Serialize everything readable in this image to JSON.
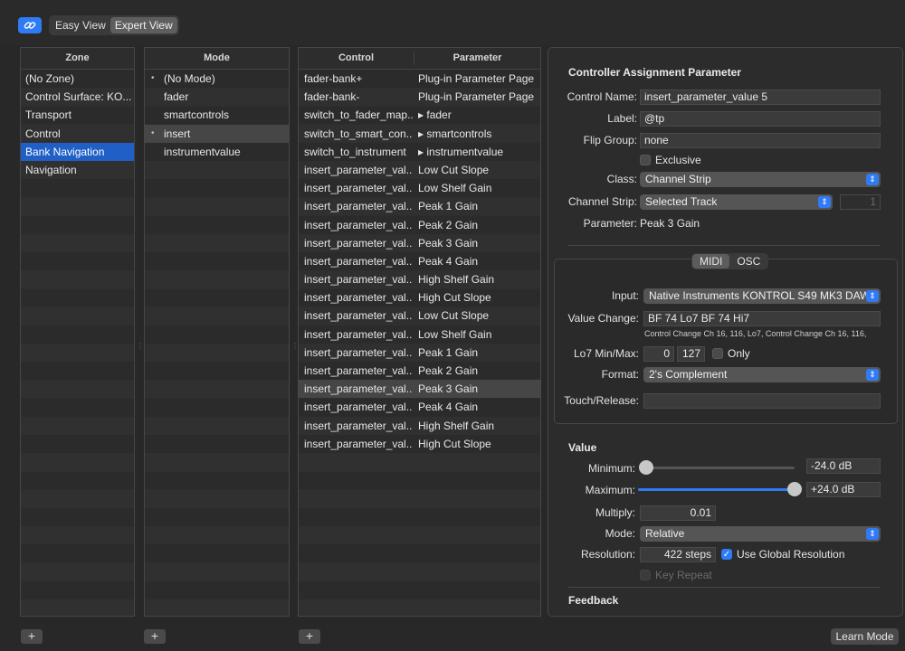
{
  "toolbar": {
    "link_icon": "link-icon",
    "view_modes": [
      "Easy View",
      "Expert View"
    ],
    "active_view": "Expert View"
  },
  "zone": {
    "header": "Zone",
    "items": [
      "(No Zone)",
      "Control Surface: KO...",
      "Transport",
      "Control",
      "Bank Navigation",
      "Navigation"
    ],
    "selected": "Bank Navigation"
  },
  "mode": {
    "header": "Mode",
    "items": [
      "(No Mode)",
      "fader",
      "smartcontrols",
      "insert",
      "instrumentvalue"
    ],
    "bulleted": [
      "(No Mode)",
      "insert"
    ],
    "selected": "insert"
  },
  "control": {
    "header_control": "Control",
    "header_parameter": "Parameter",
    "rows": [
      {
        "control": "fader-bank+",
        "parameter": "Plug-in Parameter Page"
      },
      {
        "control": "fader-bank-",
        "parameter": "Plug-in Parameter Page"
      },
      {
        "control": "switch_to_fader_map...",
        "parameter": "▸ fader"
      },
      {
        "control": "switch_to_smart_con...",
        "parameter": "▸ smartcontrols"
      },
      {
        "control": "switch_to_instrument",
        "parameter": "▸ instrumentvalue"
      },
      {
        "control": "insert_parameter_val...",
        "parameter": "Low Cut Slope"
      },
      {
        "control": "insert_parameter_val...",
        "parameter": "Low Shelf Gain"
      },
      {
        "control": "insert_parameter_val...",
        "parameter": "Peak 1 Gain"
      },
      {
        "control": "insert_parameter_val...",
        "parameter": "Peak 2 Gain"
      },
      {
        "control": "insert_parameter_val...",
        "parameter": "Peak 3 Gain"
      },
      {
        "control": "insert_parameter_val...",
        "parameter": "Peak 4 Gain"
      },
      {
        "control": "insert_parameter_val...",
        "parameter": "High Shelf Gain"
      },
      {
        "control": "insert_parameter_val...",
        "parameter": "High Cut Slope"
      },
      {
        "control": "insert_parameter_val...",
        "parameter": "Low Cut Slope"
      },
      {
        "control": "insert_parameter_val...",
        "parameter": "Low Shelf Gain"
      },
      {
        "control": "insert_parameter_val...",
        "parameter": "Peak 1 Gain"
      },
      {
        "control": "insert_parameter_val...",
        "parameter": "Peak 2 Gain"
      },
      {
        "control": "insert_parameter_val...",
        "parameter": "Peak 3 Gain"
      },
      {
        "control": "insert_parameter_val...",
        "parameter": "Peak 4 Gain"
      },
      {
        "control": "insert_parameter_val...",
        "parameter": "High Shelf Gain"
      },
      {
        "control": "insert_parameter_val...",
        "parameter": "High Cut Slope"
      }
    ],
    "selected_row": 17
  },
  "add_label": "+",
  "inspector": {
    "title": "Controller Assignment Parameter",
    "control_name_label": "Control Name:",
    "control_name": "insert_parameter_value 5",
    "label_label": "Label:",
    "label": "@tp",
    "flip_group_label": "Flip Group:",
    "flip_group": "none",
    "exclusive_label": "Exclusive",
    "class_label": "Class:",
    "class": "Channel Strip",
    "channel_strip_label": "Channel Strip:",
    "channel_strip": "Selected Track",
    "channel_number": "1",
    "parameter_label": "Parameter:",
    "parameter": "Peak 3 Gain",
    "tabs": [
      "MIDI",
      "OSC"
    ],
    "active_tab": "MIDI",
    "input_label": "Input:",
    "input": "Native Instruments KONTROL S49 MK3 DAW",
    "value_change_label": "Value Change:",
    "value_change": "BF 74 Lo7 BF 74 Hi7",
    "value_change_desc": "Control Change Ch 16, 116, Lo7, Control Change Ch 16, 116,",
    "lo7_label": "Lo7 Min/Max:",
    "lo7_min": "0",
    "lo7_max": "127",
    "only_label": "Only",
    "format_label": "Format:",
    "format": "2's Complement",
    "touch_label": "Touch/Release:",
    "touch": "",
    "value_title": "Value",
    "minimum_label": "Minimum:",
    "minimum": "-24.0 dB",
    "minimum_level": 0.0,
    "maximum_label": "Maximum:",
    "maximum": "+24.0 dB",
    "maximum_level": 1.0,
    "multiply_label": "Multiply:",
    "multiply": "0.01",
    "mode_label": "Mode:",
    "mode": "Relative",
    "resolution_label": "Resolution:",
    "resolution": "422 steps",
    "use_global_label": "Use Global Resolution",
    "use_global_checked": true,
    "key_repeat_label": "Key Repeat",
    "feedback_title": "Feedback"
  },
  "learn_mode": "Learn Mode",
  "colors": {
    "accent": "#2f7bf6",
    "selection": "#1f5fc6"
  }
}
